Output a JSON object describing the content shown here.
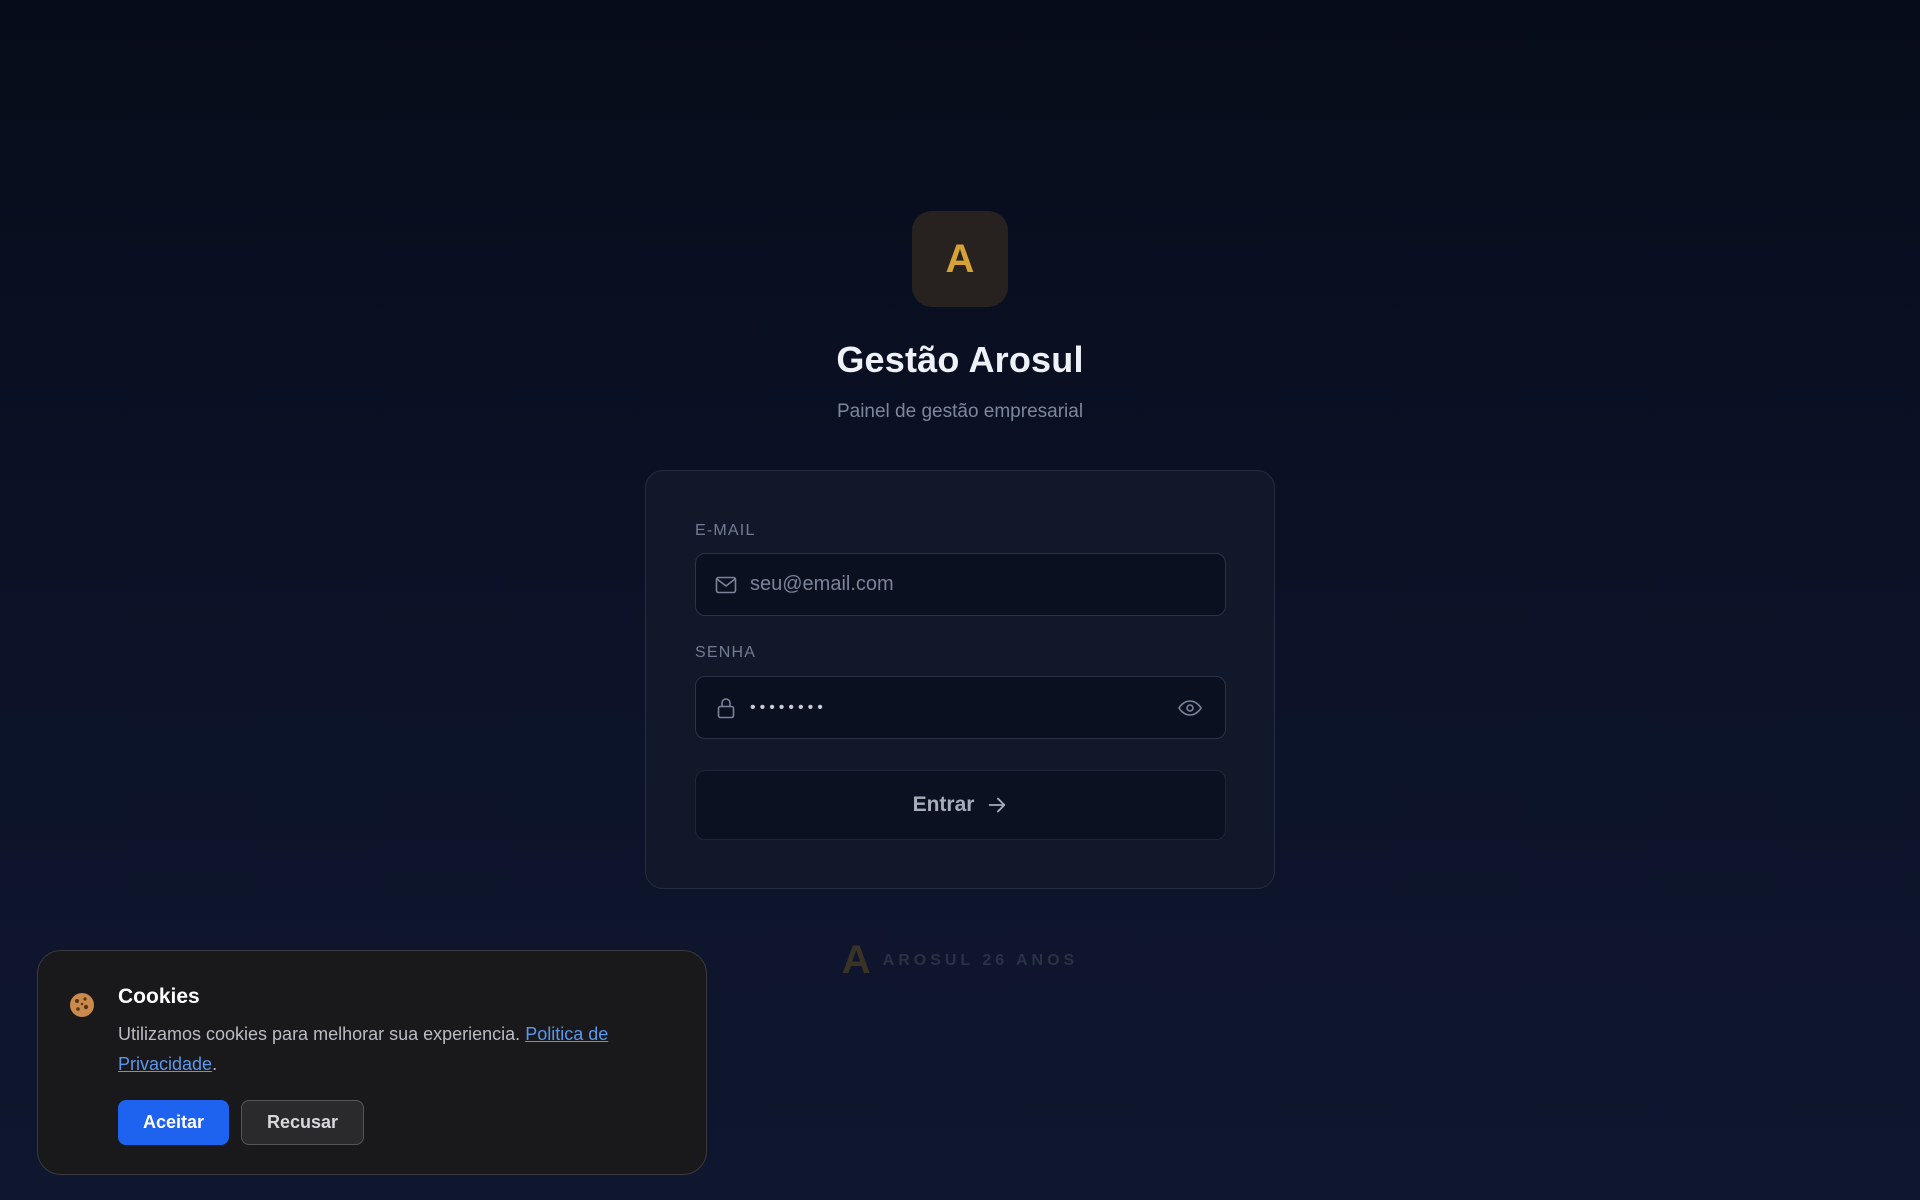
{
  "brand": {
    "logo_letter": "A",
    "title": "Gestão Arosul",
    "subtitle": "Painel de gestão empresarial",
    "accent_color": "#d6a236"
  },
  "login": {
    "email_label": "E-MAIL",
    "email_placeholder": "seu@email.com",
    "email_icon": "mail-icon",
    "password_label": "SENHA",
    "password_value": "••••••••",
    "password_icon": "lock-icon",
    "toggle_icon": "eye-icon",
    "submit_label": "Entrar",
    "submit_icon": "arrow-right-icon"
  },
  "footer": {
    "mark": "A",
    "text": "AROSUL 26 ANOS"
  },
  "cookie": {
    "icon": "cookie-icon",
    "title": "Cookies",
    "text": "Utilizamos cookies para melhorar sua experiencia.",
    "link_text": "Politica de Privacidade",
    "after_link": ".",
    "accept_label": "Aceitar",
    "reject_label": "Recusar",
    "accept_color": "#1e63f0"
  }
}
